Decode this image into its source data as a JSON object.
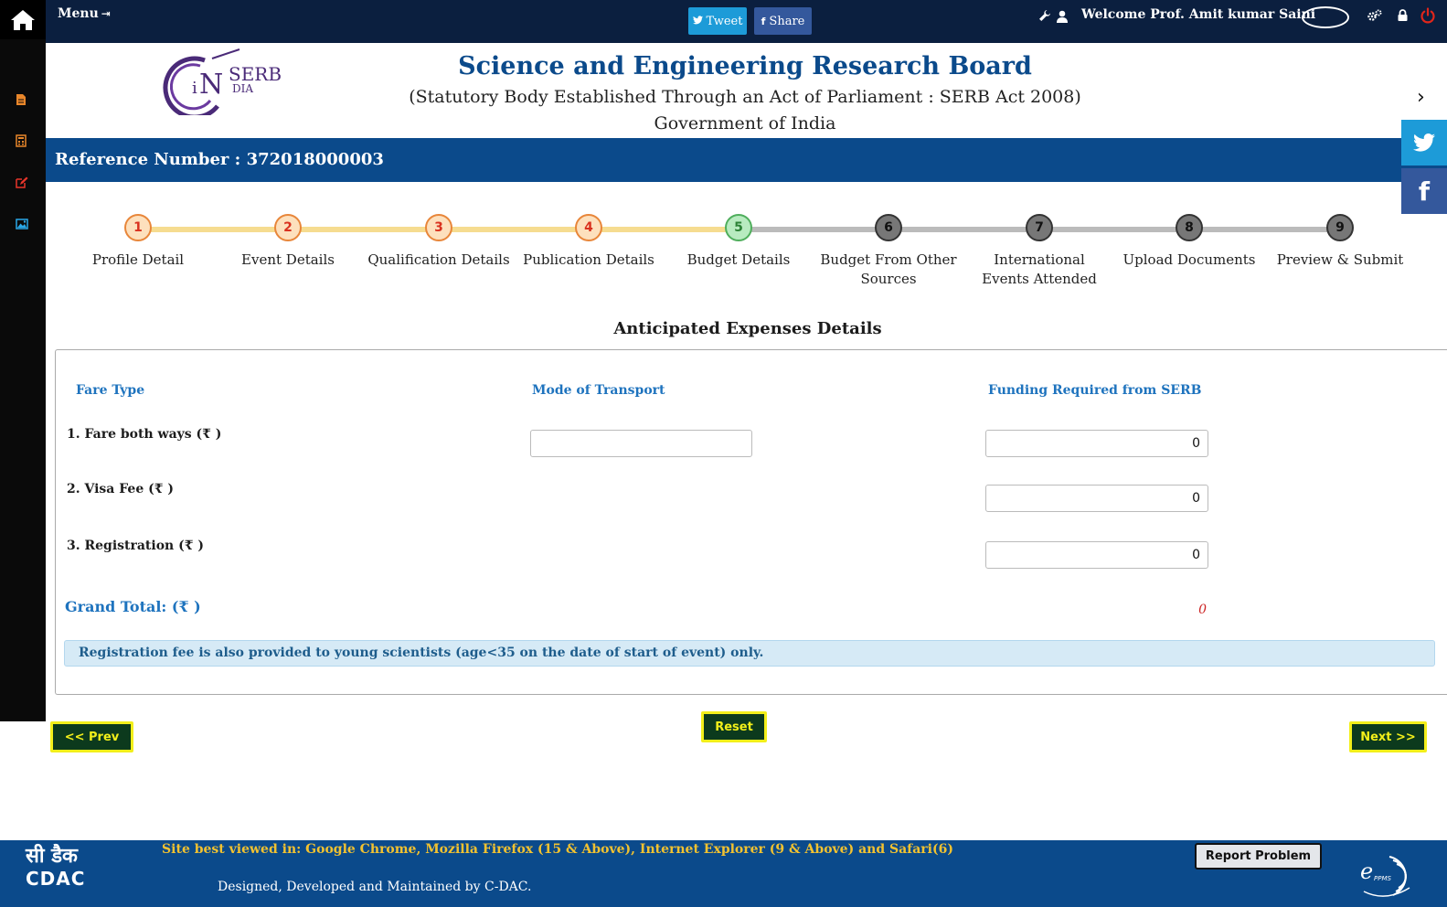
{
  "topbar": {
    "menu_label": "Menu",
    "tweet_label": "Tweet",
    "share_label": "Share",
    "welcome_text": "Welcome Prof. Amit kumar Saini",
    "icons": [
      "home-icon",
      "sign-in-icon",
      "twitter-icon",
      "facebook-icon",
      "wrench-icon",
      "user-icon",
      "gears-icon",
      "lock-icon",
      "power-icon"
    ]
  },
  "sidebar": {
    "items": [
      {
        "icon": "document-icon",
        "color": "#e8862a"
      },
      {
        "icon": "calculator-icon",
        "color": "#e8862a"
      },
      {
        "icon": "edit-icon",
        "color": "#e8352a"
      },
      {
        "icon": "image-icon",
        "color": "#2aa8e8"
      }
    ]
  },
  "header": {
    "logo_text_main": "SERB",
    "logo_text_i": "i",
    "logo_text_n": "N",
    "logo_text_dia": "DIA",
    "title": "Science and Engineering Research Board",
    "subtitle": "(Statutory Body Established Through an Act of Parliament : SERB Act 2008)",
    "government": "Government of India",
    "title_color": "#0b4a8b"
  },
  "reference": {
    "label": "Reference Number : 372018000003"
  },
  "stepper": {
    "current_step": 5,
    "steps": [
      {
        "num": "1",
        "label": "Profile Detail",
        "state": "done"
      },
      {
        "num": "2",
        "label": "Event Details",
        "state": "done"
      },
      {
        "num": "3",
        "label": "Qualification Details",
        "state": "done"
      },
      {
        "num": "4",
        "label": "Publication Details",
        "state": "done"
      },
      {
        "num": "5",
        "label": "Budget Details",
        "state": "active"
      },
      {
        "num": "6",
        "label": "Budget From Other Sources",
        "state": "todo"
      },
      {
        "num": "7",
        "label": "International Events Attended",
        "state": "todo"
      },
      {
        "num": "8",
        "label": "Upload Documents",
        "state": "todo"
      },
      {
        "num": "9",
        "label": "Preview & Submit",
        "state": "todo"
      }
    ]
  },
  "form": {
    "section_title": "Anticipated Expenses Details",
    "col_fare_type": "Fare Type",
    "col_mode": "Mode of Transport",
    "col_funding": "Funding Required from SERB",
    "rows": [
      {
        "label": "1.  Fare both ways  (₹ )",
        "mode_value": "",
        "funding_value": "0"
      },
      {
        "label": "2.  Visa Fee  (₹ )",
        "funding_value": "0"
      },
      {
        "label": "3.  Registration  (₹ )",
        "funding_value": "0"
      }
    ],
    "grand_total_label": "Grand Total:  (₹ )",
    "grand_total_value": "0",
    "note": "Registration fee is also provided to young scientists (age<35 on the date of start of event) only."
  },
  "actions": {
    "prev_label": "<< Prev",
    "reset_label": "Reset",
    "next_label": "Next >>"
  },
  "footer": {
    "cdac_hindi": "सी डैक",
    "cdac_english": "CDAC",
    "best_viewed": "Site best viewed in: Google Chrome, Mozilla Firefox (15 & Above), Internet Explorer (9 & Above) and Safari(6)",
    "designed_by": "Designed, Developed and Maintained by C-DAC.",
    "report_label": "Report Problem",
    "eppms_e": "e",
    "eppms_text": "PPMS"
  }
}
